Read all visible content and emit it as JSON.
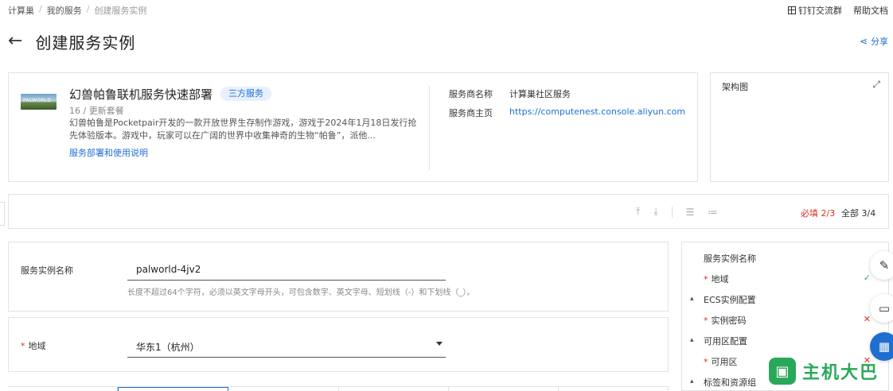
{
  "breadcrumb": [
    "计算巢",
    "我的服务",
    "创建服务实例"
  ],
  "top_right": {
    "dingtalk": "钉钉交流群",
    "help": "帮助文档"
  },
  "page": {
    "title": "创建服务实例",
    "share": "分享"
  },
  "service": {
    "thumb_text": "PALWORLD",
    "title": "幻兽帕鲁联机服务快速部署",
    "badge": "三方服务",
    "version": "16 / 更新套餐",
    "description": "幻兽帕鲁是Pocketpair开发的一款开放世界生存制作游戏，游戏于2024年1月18日发行抢先体验版本。游戏中，玩家可以在广阔的世界中收集神奇的生物“帕鲁”，派他...",
    "doc_link": "服务部署和使用说明",
    "provider_label": "服务商名称",
    "provider_value": "计算巢社区服务",
    "homepage_label": "服务商主页",
    "homepage_value": "https://computenest.console.aliyun.com"
  },
  "architecture": {
    "title": "架构图"
  },
  "toolbar": {
    "required": "必填 2/3",
    "all": "全部 3/4"
  },
  "form": {
    "name_label": "服务实例名称",
    "name_value": "palworld-4jv2",
    "name_hint": "长度不超过64个字符，必须以英文字母开头，可包含数字、英文字母、短划线（-）和下划线（_）。",
    "region_label": "地域",
    "region_value": "华东1（杭州）"
  },
  "outline": {
    "items": [
      "服务实例名称",
      "地域",
      "ECS实例配置",
      "实例密码",
      "可用区配置",
      "可用区",
      "标签和资源组"
    ]
  },
  "watermark": {
    "text": "主机大巴"
  }
}
